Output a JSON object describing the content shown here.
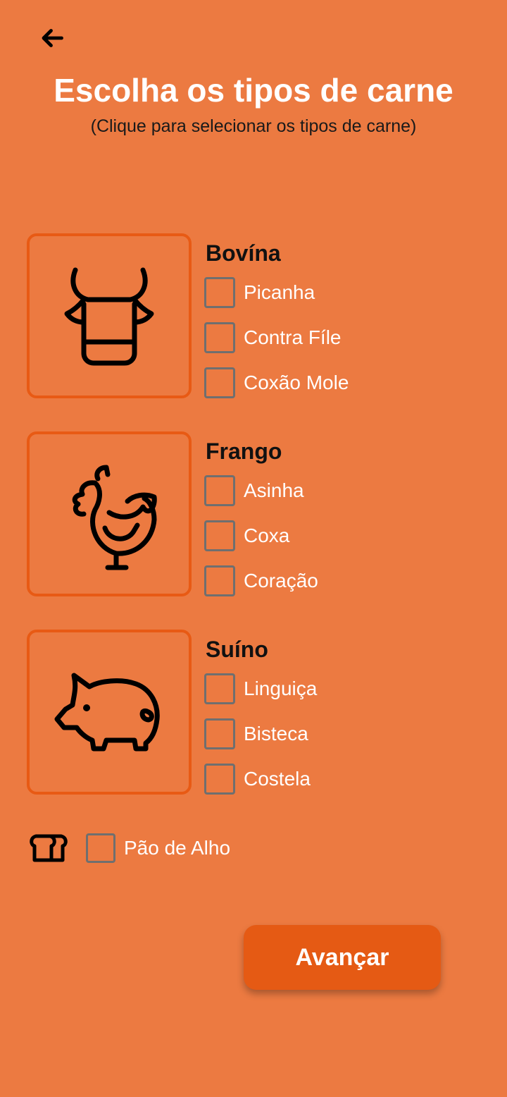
{
  "header": {
    "back_icon": "arrow-left-icon",
    "title": "Escolha os tipos de carne",
    "subtitle": "(Clique para selecionar os tipos de carne)"
  },
  "categories": [
    {
      "title": "Bovína",
      "icon": "cow-icon",
      "options": [
        {
          "label": "Picanha",
          "checked": false
        },
        {
          "label": "Contra Fíle",
          "checked": false
        },
        {
          "label": "Coxão Mole",
          "checked": false
        }
      ]
    },
    {
      "title": "Frango",
      "icon": "rooster-icon",
      "options": [
        {
          "label": "Asinha",
          "checked": false
        },
        {
          "label": "Coxa",
          "checked": false
        },
        {
          "label": "Coração",
          "checked": false
        }
      ]
    },
    {
      "title": "Suíno",
      "icon": "pig-icon",
      "options": [
        {
          "label": "Linguiça",
          "checked": false
        },
        {
          "label": "Bisteca",
          "checked": false
        },
        {
          "label": "Costela",
          "checked": false
        }
      ]
    }
  ],
  "extra": {
    "icon": "bread-icon",
    "label": "Pão de Alho",
    "checked": false
  },
  "footer": {
    "next_label": "Avançar"
  },
  "colors": {
    "background": "#EC7A41",
    "accent": "#E55A14",
    "checkbox_border": "#6F6F6F"
  }
}
